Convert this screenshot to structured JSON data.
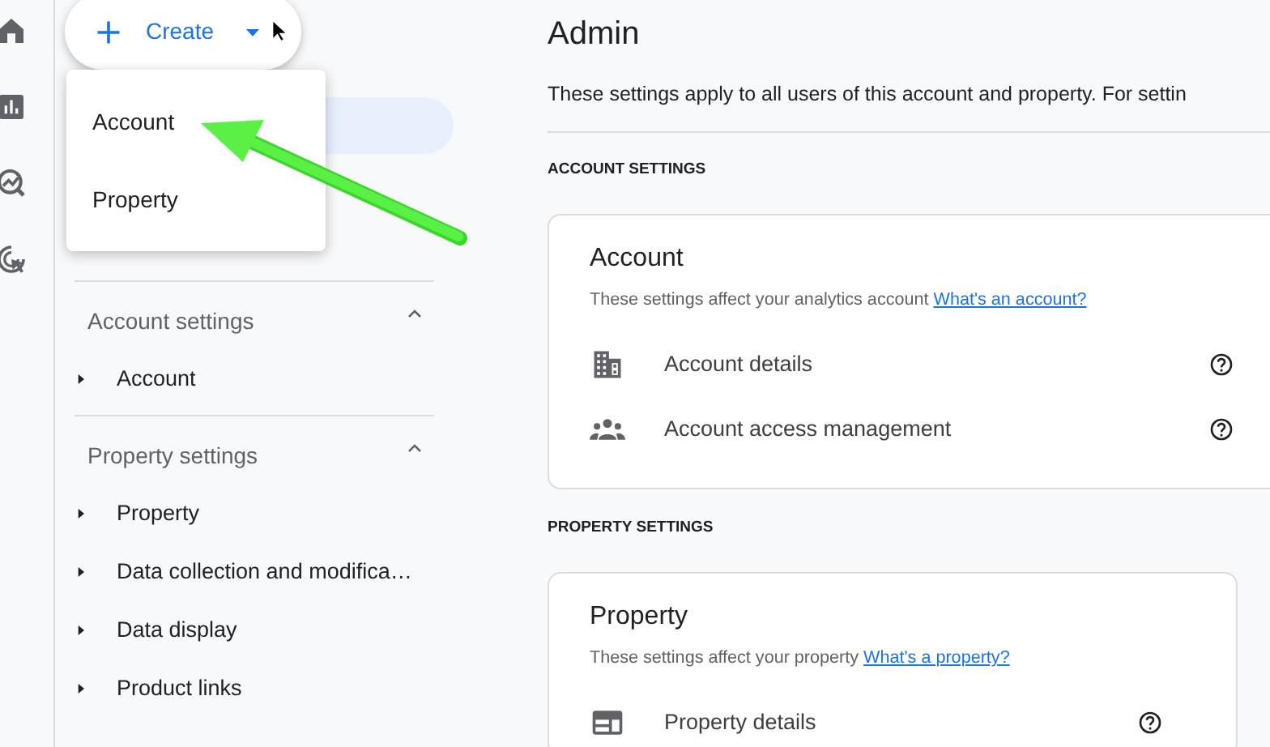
{
  "create_button": {
    "label": "Create"
  },
  "create_menu": {
    "items": [
      {
        "label": "Account"
      },
      {
        "label": "Property"
      }
    ]
  },
  "sidebar": {
    "sections": [
      {
        "title": "Account settings",
        "expanded": true,
        "items": [
          {
            "label": "Account"
          }
        ]
      },
      {
        "title": "Property settings",
        "expanded": true,
        "items": [
          {
            "label": "Property"
          },
          {
            "label": "Data collection and modifica…"
          },
          {
            "label": "Data display"
          },
          {
            "label": "Product links"
          }
        ]
      }
    ]
  },
  "main": {
    "title": "Admin",
    "description": "These settings apply to all users of this account and property. For settin",
    "sections": [
      {
        "heading": "ACCOUNT SETTINGS",
        "card": {
          "title": "Account",
          "description": "These settings affect your analytics account",
          "link": "What's an account?",
          "rows": [
            {
              "kind": "building",
              "label": "Account details"
            },
            {
              "kind": "people",
              "label": "Account access management"
            }
          ]
        }
      },
      {
        "heading": "PROPERTY SETTINGS",
        "card": {
          "title": "Property",
          "description": "These settings affect your property",
          "link": "What's a property?",
          "rows": [
            {
              "kind": "layout",
              "label": "Property details"
            }
          ]
        }
      }
    ]
  }
}
